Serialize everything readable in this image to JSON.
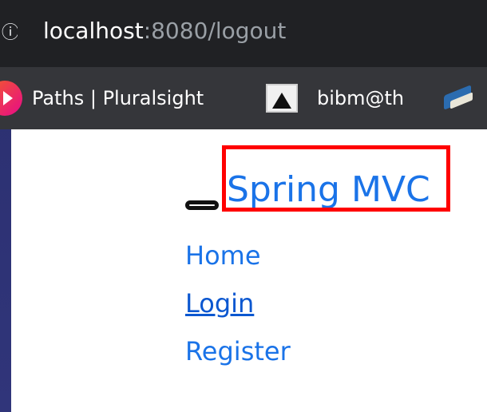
{
  "address_bar": {
    "url_host": "localhost",
    "url_rest": ":8080/logout",
    "info_icon": "info-icon"
  },
  "bookmarks": [
    {
      "label": "Paths | Pluralsight",
      "icon": "pluralsight-icon"
    },
    {
      "label": "bibm@th",
      "icon": "bibmath-icon"
    },
    {
      "label": "",
      "icon": "book-icon"
    }
  ],
  "page": {
    "brand": "Spring MVC",
    "nav_links": [
      {
        "label": "Home"
      },
      {
        "label": "Login"
      },
      {
        "label": "Register"
      }
    ]
  },
  "colors": {
    "link": "#1a73e8",
    "highlight": "#ff0000",
    "addressbar_bg": "#202124",
    "bookmarks_bg": "#35363a"
  }
}
